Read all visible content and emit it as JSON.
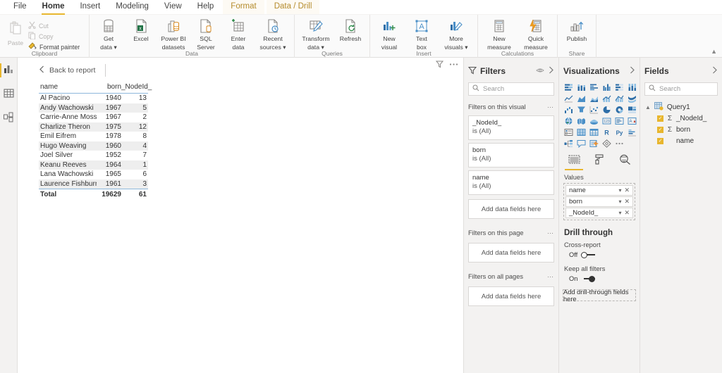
{
  "ribbon": {
    "tabs": [
      {
        "label": "File",
        "state": "normal"
      },
      {
        "label": "Home",
        "state": "active"
      },
      {
        "label": "Insert",
        "state": "normal"
      },
      {
        "label": "Modeling",
        "state": "normal"
      },
      {
        "label": "View",
        "state": "normal"
      },
      {
        "label": "Help",
        "state": "normal"
      },
      {
        "label": "Format",
        "state": "contextual"
      },
      {
        "label": "Data / Drill",
        "state": "contextual"
      }
    ],
    "groups": [
      {
        "name": "Clipboard",
        "label": "Clipboard",
        "paste": {
          "label": "Paste",
          "icon": "paste-icon",
          "enabled": false
        },
        "commands": [
          {
            "label": "Cut",
            "icon": "scissors-icon",
            "enabled": false
          },
          {
            "label": "Copy",
            "icon": "copy-icon",
            "enabled": false
          },
          {
            "label": "Format painter",
            "icon": "format-painter-icon",
            "enabled": true
          }
        ]
      },
      {
        "name": "Data",
        "label": "Data",
        "buttons": [
          {
            "label": "Get\ndata",
            "l1": "Get",
            "l2": "data",
            "caret": true,
            "icon": "database-icon"
          },
          {
            "label": "Excel",
            "l1": "Excel",
            "l2": "",
            "caret": false,
            "icon": "excel-icon"
          },
          {
            "label": "Power BI datasets",
            "l1": "Power BI",
            "l2": "datasets",
            "caret": false,
            "icon": "powerbi-datasets-icon"
          },
          {
            "label": "SQL Server",
            "l1": "SQL",
            "l2": "Server",
            "caret": false,
            "icon": "sql-server-icon"
          },
          {
            "label": "Enter data",
            "l1": "Enter",
            "l2": "data",
            "caret": false,
            "icon": "enter-data-icon"
          },
          {
            "label": "Recent sources",
            "l1": "Recent",
            "l2": "sources",
            "caret": true,
            "icon": "recent-sources-icon"
          }
        ]
      },
      {
        "name": "Queries",
        "label": "Queries",
        "buttons": [
          {
            "label": "Transform data",
            "l1": "Transform",
            "l2": "data",
            "caret": true,
            "icon": "transform-data-icon"
          },
          {
            "label": "Refresh",
            "l1": "Refresh",
            "l2": "",
            "caret": false,
            "icon": "refresh-icon"
          }
        ]
      },
      {
        "name": "Insert",
        "label": "Insert",
        "buttons": [
          {
            "label": "New visual",
            "l1": "New",
            "l2": "visual",
            "caret": false,
            "icon": "new-visual-icon"
          },
          {
            "label": "Text box",
            "l1": "Text",
            "l2": "box",
            "caret": false,
            "icon": "text-box-icon"
          },
          {
            "label": "More visuals",
            "l1": "More",
            "l2": "visuals",
            "caret": true,
            "icon": "more-visuals-icon"
          }
        ]
      },
      {
        "name": "Calculations",
        "label": "Calculations",
        "buttons": [
          {
            "label": "New measure",
            "l1": "New",
            "l2": "measure",
            "caret": false,
            "icon": "new-measure-icon"
          },
          {
            "label": "Quick measure",
            "l1": "Quick",
            "l2": "measure",
            "caret": false,
            "icon": "quick-measure-icon"
          }
        ]
      },
      {
        "name": "Share",
        "label": "Share",
        "buttons": [
          {
            "label": "Publish",
            "l1": "Publish",
            "l2": "",
            "caret": false,
            "icon": "publish-icon"
          }
        ]
      }
    ]
  },
  "leftnav": {
    "items": [
      {
        "name": "report-view",
        "icon": "bar-chart-icon",
        "selected": true
      },
      {
        "name": "data-view",
        "icon": "table-icon",
        "selected": false
      },
      {
        "name": "model-view",
        "icon": "model-relationships-icon",
        "selected": false
      }
    ]
  },
  "canvas": {
    "back_to_report": "Back to report",
    "visual_tools": [
      {
        "name": "filter-icon",
        "glyph": "filter"
      },
      {
        "name": "more-options-icon",
        "glyph": "dots"
      }
    ],
    "table": {
      "columns": [
        "name",
        "born",
        "_NodeId_"
      ],
      "rows": [
        {
          "name": "Al Pacino",
          "born": "1940",
          "node": "13"
        },
        {
          "name": "Andy Wachowski",
          "born": "1967",
          "node": "5"
        },
        {
          "name": "Carrie-Anne Moss",
          "born": "1967",
          "node": "2"
        },
        {
          "name": "Charlize Theron",
          "born": "1975",
          "node": "12"
        },
        {
          "name": "Emil Eifrem",
          "born": "1978",
          "node": "8"
        },
        {
          "name": "Hugo Weaving",
          "born": "1960",
          "node": "4"
        },
        {
          "name": "Joel Silver",
          "born": "1952",
          "node": "7"
        },
        {
          "name": "Keanu Reeves",
          "born": "1964",
          "node": "1"
        },
        {
          "name": "Lana Wachowski",
          "born": "1965",
          "node": "6"
        },
        {
          "name": "Laurence Fishburne",
          "born": "1961",
          "node": "3"
        }
      ],
      "total": {
        "name": "Total",
        "born": "19629",
        "node": "61"
      }
    }
  },
  "filters": {
    "title": "Filters",
    "icon": "funnel-icon",
    "hide_icon": "eye-hide-icon",
    "collapse_icon": "chevron-right-icon",
    "search_placeholder": "Search",
    "sections": [
      {
        "label": "Filters on this visual",
        "cards": [
          {
            "field": "_NodeId_",
            "state": "is (All)"
          },
          {
            "field": "born",
            "state": "is (All)"
          },
          {
            "field": "name",
            "state": "is (All)"
          }
        ],
        "dropzone": "Add data fields here"
      },
      {
        "label": "Filters on this page",
        "cards": [],
        "dropzone": "Add data fields here"
      },
      {
        "label": "Filters on all pages",
        "cards": [],
        "dropzone": "Add data fields here"
      }
    ]
  },
  "visualizations": {
    "title": "Visualizations",
    "collapse_icon": "chevron-right-icon",
    "icons": [
      "stacked-bar-chart-icon",
      "stacked-column-chart-icon",
      "clustered-bar-chart-icon",
      "clustered-column-chart-icon",
      "100-stacked-bar-chart-icon",
      "100-stacked-column-chart-icon",
      "line-chart-icon",
      "area-chart-icon",
      "stacked-area-chart-icon",
      "line-stacked-column-chart-icon",
      "line-clustered-column-chart-icon",
      "ribbon-chart-icon",
      "waterfall-chart-icon",
      "funnel-chart-icon",
      "scatter-chart-icon",
      "pie-chart-icon",
      "donut-chart-icon",
      "treemap-icon",
      "map-icon",
      "filled-map-icon",
      "arcgis-map-icon",
      "card-icon",
      "multi-row-card-icon",
      "kpi-icon",
      "slicer-icon",
      "table-icon",
      "matrix-icon",
      "r-script-visual-icon",
      "python-visual-icon",
      "key-influencers-icon",
      "decomposition-tree-icon",
      "q-and-a-icon",
      "smart-narrative-icon",
      "paginated-report-icon",
      "more-visuals-ellipsis-icon"
    ],
    "tabs": [
      {
        "name": "fields-tab",
        "icon": "fields-well-icon",
        "selected": true
      },
      {
        "name": "format-tab",
        "icon": "paint-roller-icon",
        "selected": false
      },
      {
        "name": "analytics-tab",
        "icon": "magnifier-analytics-icon",
        "selected": false
      }
    ],
    "well_label": "Values",
    "well_fields": [
      {
        "name": "name"
      },
      {
        "name": "born"
      },
      {
        "name": "_NodeId_"
      }
    ],
    "drill_through": {
      "title": "Drill through",
      "cross_report": {
        "label": "Cross-report",
        "state": "Off",
        "on": false
      },
      "keep_all_filters": {
        "label": "Keep all filters",
        "state": "On",
        "on": true
      },
      "dropzone": "Add drill-through fields here"
    }
  },
  "fields": {
    "title": "Fields",
    "collapse_icon": "chevron-right-icon",
    "search_placeholder": "Search",
    "table": {
      "name": "Query1",
      "icon": "table-entity-icon",
      "expanded": true,
      "fields": [
        {
          "name": "_NodeId_",
          "checked": true,
          "measure": true
        },
        {
          "name": "born",
          "checked": true,
          "measure": true
        },
        {
          "name": "name",
          "checked": true,
          "measure": false
        }
      ]
    }
  }
}
